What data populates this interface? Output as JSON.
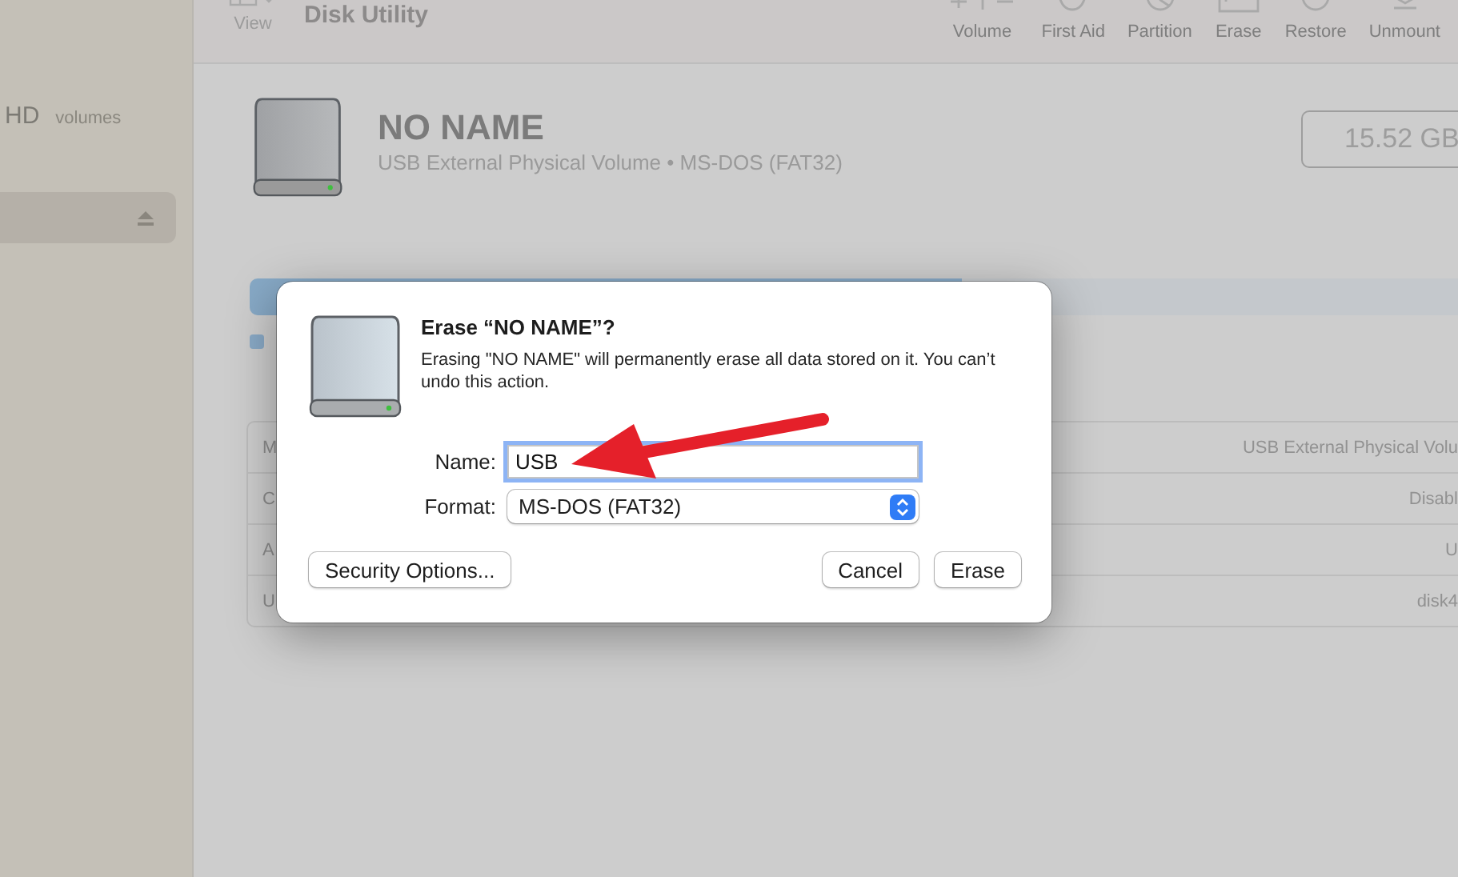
{
  "window": {
    "title": "Disk Utility"
  },
  "toolbar": {
    "view_label": "View",
    "items": [
      {
        "label": "Volume",
        "kind": "volume"
      },
      {
        "label": "First Aid",
        "kind": "firstaid"
      },
      {
        "label": "Partition",
        "kind": "partition"
      },
      {
        "label": "Erase",
        "kind": "erase"
      },
      {
        "label": "Restore",
        "kind": "restore"
      },
      {
        "label": "Unmount",
        "kind": "unmount"
      }
    ]
  },
  "sidebar": {
    "section_label": "HD",
    "section_note": "volumes",
    "items": [
      {
        "selected": true
      }
    ]
  },
  "volume": {
    "name": "NO NAME",
    "subtitle": "USB External Physical Volume • MS-DOS (FAT32)",
    "capacity": "15.52 GB"
  },
  "usage": {
    "level": 0.59
  },
  "info": {
    "rows": [
      {
        "label": "M",
        "value": "USB External Physical Volu"
      },
      {
        "label": "C",
        "value": "Disabl"
      },
      {
        "label": "A",
        "value": "U"
      },
      {
        "label": "U",
        "value": "disk4"
      }
    ]
  },
  "dialog": {
    "title": "Erase “NO NAME”?",
    "message": "Erasing \"NO NAME\" will permanently erase all data stored on it. You can’t undo this action.",
    "name_label": "Name:",
    "name_value": "USB",
    "format_label": "Format:",
    "format_value": "MS-DOS (FAT32)",
    "buttons": [
      {
        "label": "Security Options...",
        "kind": "left"
      },
      {
        "label": "Cancel",
        "kind": "right"
      },
      {
        "label": "Erase",
        "kind": "right"
      }
    ]
  }
}
